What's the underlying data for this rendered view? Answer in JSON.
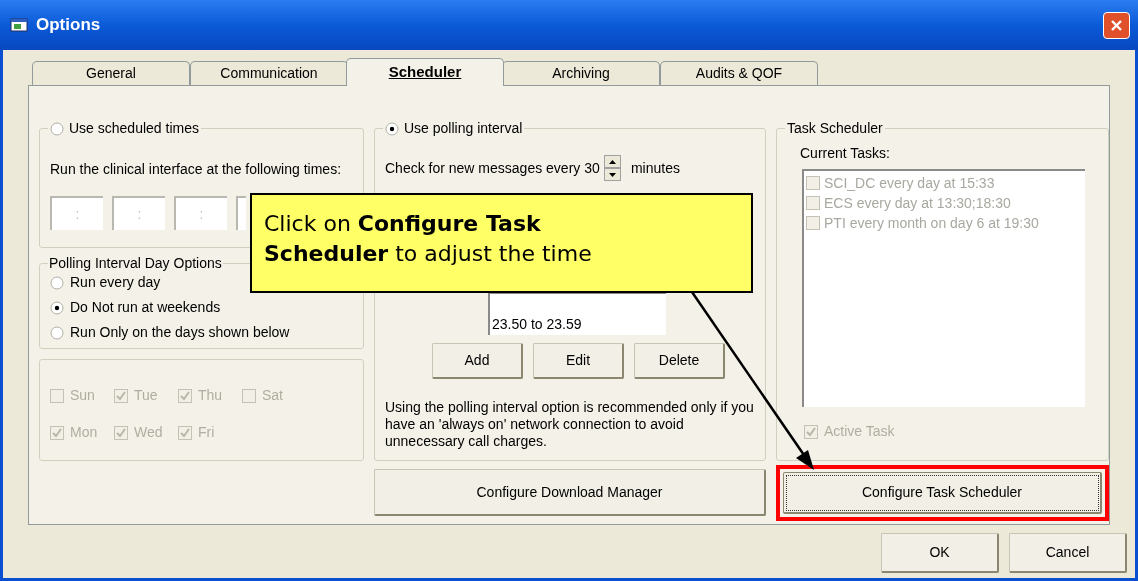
{
  "window": {
    "title": "Options"
  },
  "tabs": [
    {
      "label": "General",
      "selected": false
    },
    {
      "label": "Communication",
      "selected": false
    },
    {
      "label": "Scheduler",
      "selected": true
    },
    {
      "label": "Archiving",
      "selected": false
    },
    {
      "label": "Audits & QOF",
      "selected": false
    }
  ],
  "scheduled_times": {
    "label": "Use scheduled times",
    "selected": false,
    "prompt": "Run the clinical interface at the following times:",
    "time_fields": [
      ":",
      ":",
      ":"
    ]
  },
  "day_options": {
    "title": "Polling Interval Day Options",
    "options": [
      {
        "label": "Run every day",
        "selected": false
      },
      {
        "label": "Do Not run at weekends",
        "selected": true
      },
      {
        "label": "Run Only on the days shown below",
        "selected": false
      }
    ]
  },
  "days": [
    {
      "label": "Sun",
      "checked": false,
      "disabled": true
    },
    {
      "label": "Mon",
      "checked": true,
      "disabled": true
    },
    {
      "label": "Tue",
      "checked": true,
      "disabled": true
    },
    {
      "label": "Wed",
      "checked": true,
      "disabled": true
    },
    {
      "label": "Thu",
      "checked": true,
      "disabled": true
    },
    {
      "label": "Fri",
      "checked": true,
      "disabled": true
    },
    {
      "label": "Sat",
      "checked": false,
      "disabled": true
    }
  ],
  "polling": {
    "label": "Use polling interval",
    "selected": true,
    "check_prefix": "Check for new messages every",
    "interval": "30",
    "check_suffix": "minutes",
    "times": [
      "23.50 to 23.59"
    ],
    "buttons": [
      "Add",
      "Edit",
      "Delete"
    ],
    "note": "Using the polling interval option is recommended only if you have an 'always on' network connection to avoid unnecessary call charges."
  },
  "download_button": "Configure Download Manager",
  "task_scheduler": {
    "title": "Task Scheduler",
    "list_label": "Current Tasks:",
    "tasks": [
      {
        "label": "SCI_DC every day at 15:33",
        "checked": false,
        "disabled": true
      },
      {
        "label": "ECS every day at 13:30;18:30",
        "checked": false,
        "disabled": true
      },
      {
        "label": "PTI every month on day 6 at 19:30",
        "checked": false,
        "disabled": true
      }
    ],
    "active_task": {
      "label": "Active Task",
      "checked": true,
      "disabled": true
    }
  },
  "task_button": {
    "label": "Configure Task Scheduler",
    "highlighted": true
  },
  "dialog_buttons": [
    "OK",
    "Cancel"
  ],
  "callout": {
    "text": "Click on **Configure Task Scheduler** to adjust the time"
  }
}
